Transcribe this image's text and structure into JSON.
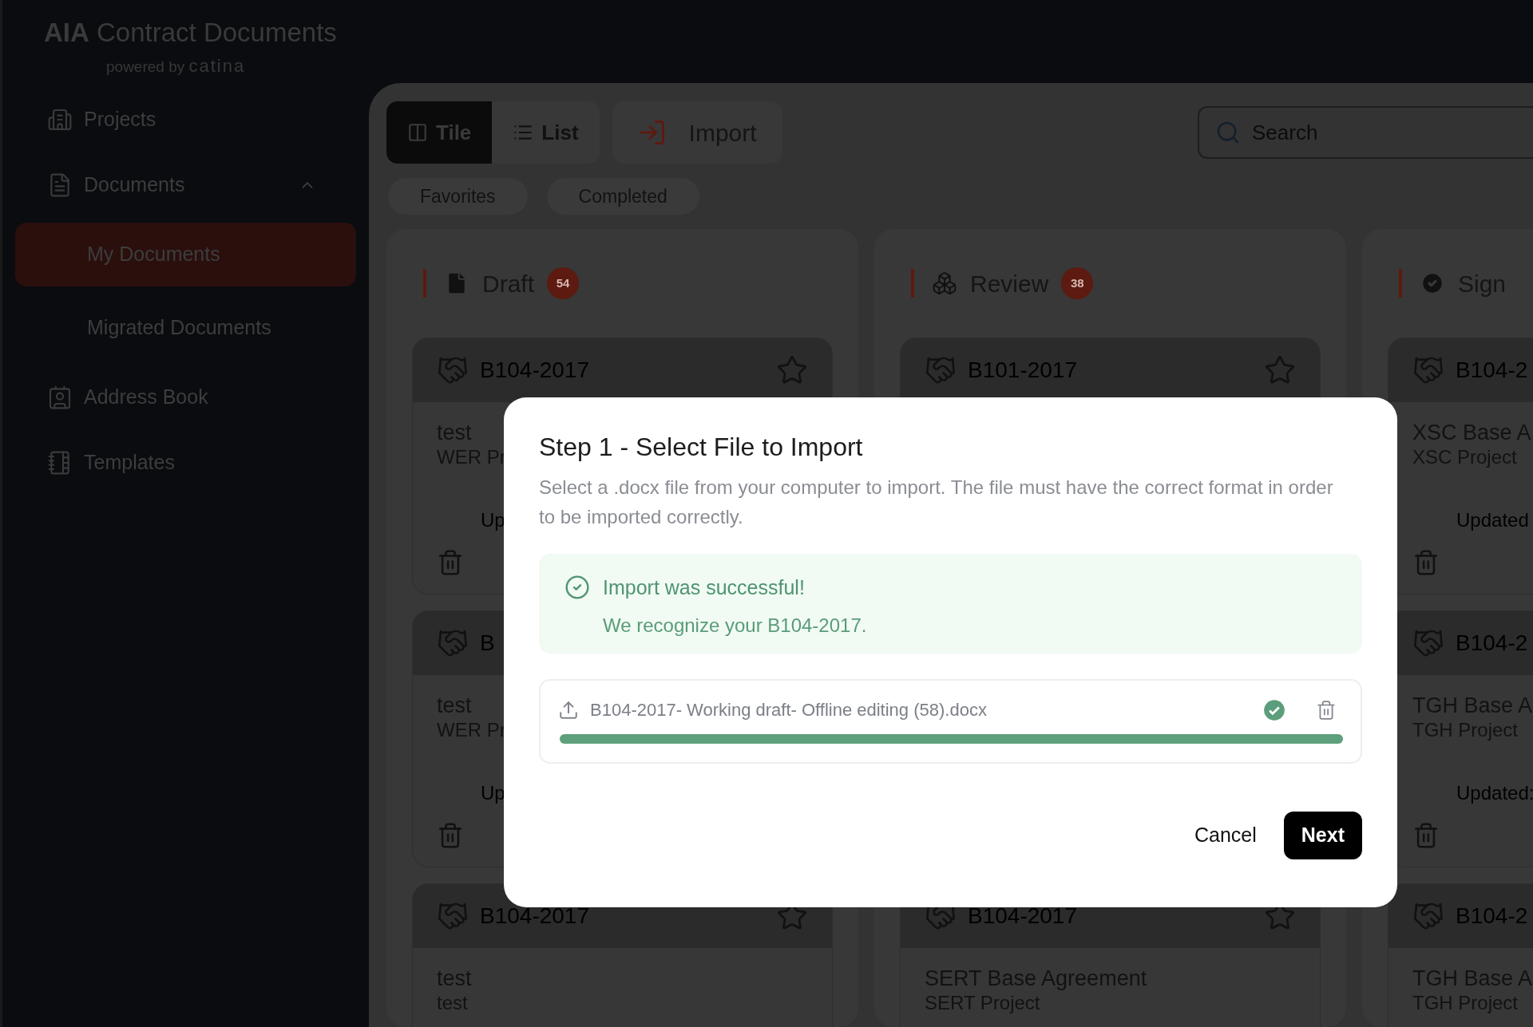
{
  "logo": {
    "brand": "AIA",
    "product": "Contract Documents",
    "powered_by": "powered by",
    "partner": "catina"
  },
  "sidebar": {
    "items": [
      {
        "label": "Projects",
        "selected": false
      },
      {
        "label": "Documents",
        "selected": false,
        "expanded": true,
        "children": [
          {
            "label": "My Documents",
            "selected": true
          },
          {
            "label": "Migrated Documents",
            "selected": false
          }
        ]
      },
      {
        "label": "Address Book",
        "selected": false
      },
      {
        "label": "Templates",
        "selected": false
      }
    ]
  },
  "toolbar": {
    "view_tabs": [
      {
        "label": "Tile",
        "selected": true
      },
      {
        "label": "List",
        "selected": false
      }
    ],
    "import_button": "Import",
    "search": {
      "placeholder": "Search"
    }
  },
  "filters": [
    {
      "label": "Favorites"
    },
    {
      "label": "Completed"
    }
  ],
  "board": {
    "columns": [
      {
        "title": "Draft",
        "count": "54",
        "cards": [
          {
            "kind": "card",
            "code": "B104-2017",
            "favorite": false,
            "title": "test",
            "subtitle": "WER Pr",
            "updated": "Up",
            "deletable": true
          },
          {
            "kind": "card",
            "code": "B",
            "title": "test",
            "subtitle": "WER Pr",
            "updated": "Up",
            "deletable": true
          },
          {
            "kind": "card",
            "code": "B104-2017",
            "favorite": false,
            "title": "test",
            "subtitle": "test"
          }
        ]
      },
      {
        "title": "Review",
        "count": "38",
        "cards": [
          {
            "kind": "card",
            "code": "B101-2017",
            "favorite": false
          },
          {
            "kind": "covered"
          },
          {
            "kind": "card",
            "code": "B104-2017",
            "favorite": false,
            "title": "SERT Base Agreement",
            "subtitle": "SERT Project"
          }
        ]
      },
      {
        "title": "Sign",
        "cards": [
          {
            "kind": "card",
            "code": "B104-2",
            "title": "XSC Base A",
            "subtitle": "XSC Project",
            "updated": "Updated",
            "deletable": true
          },
          {
            "kind": "card",
            "code": "B104-2",
            "title": "TGH Base A",
            "subtitle": "TGH Project",
            "updated": "Updated:",
            "deletable": true
          },
          {
            "kind": "card",
            "code": "B104-2",
            "title": "TGH Base A",
            "subtitle": "TGH Project"
          }
        ]
      }
    ]
  },
  "dialog": {
    "title": "Step 1 - Select File to Import",
    "description": "Select a .docx file from your computer to import. The file must have the correct format in order to be imported correctly.",
    "alert": {
      "title": "Import was successful!",
      "message": "We recognize your B104-2017."
    },
    "file": {
      "name": "B104-2017- Working draft- Offline editing (58).docx",
      "done": true,
      "level": 1
    },
    "buttons": [
      {
        "label": "Cancel",
        "kind": "text"
      },
      {
        "label": "Next",
        "kind": "primary"
      }
    ]
  }
}
